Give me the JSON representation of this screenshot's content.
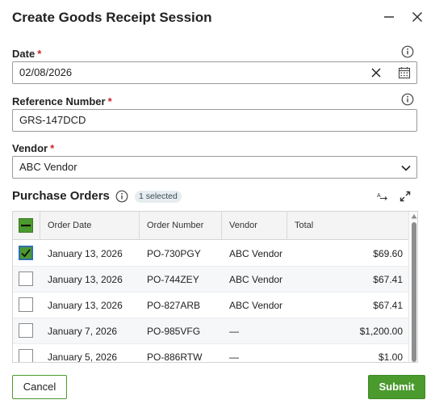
{
  "dialog": {
    "title": "Create Goods Receipt Session"
  },
  "date": {
    "label": "Date",
    "required_mark": "*",
    "value": "02/08/2026"
  },
  "reference": {
    "label": "Reference Number",
    "required_mark": "*",
    "value": "GRS-147DCD"
  },
  "vendor": {
    "label": "Vendor",
    "required_mark": "*",
    "value": "ABC Vendor"
  },
  "purchase_orders": {
    "title": "Purchase Orders",
    "badge": "1 selected",
    "columns": [
      "Order Date",
      "Order Number",
      "Vendor",
      "Total"
    ],
    "rows": [
      {
        "checked": true,
        "date": "January 13, 2026",
        "number": "PO-730PGY",
        "vendor": "ABC Vendor",
        "total": "$69.60"
      },
      {
        "checked": false,
        "date": "January 13, 2026",
        "number": "PO-744ZEY",
        "vendor": "ABC Vendor",
        "total": "$67.41"
      },
      {
        "checked": false,
        "date": "January 13, 2026",
        "number": "PO-827ARB",
        "vendor": "ABC Vendor",
        "total": "$67.41"
      },
      {
        "checked": false,
        "date": "January 7, 2026",
        "number": "PO-985VFG",
        "vendor": "—",
        "total": "$1,200.00"
      },
      {
        "checked": false,
        "date": "January 5, 2026",
        "number": "PO-886RTW",
        "vendor": "—",
        "total": "$1.00"
      }
    ]
  },
  "footer": {
    "cancel_label": "Cancel",
    "submit_label": "Submit"
  },
  "colors": {
    "accent_green": "#4a9a2e",
    "required_red": "#d0222a",
    "focus_blue": "#2f6fb2"
  }
}
